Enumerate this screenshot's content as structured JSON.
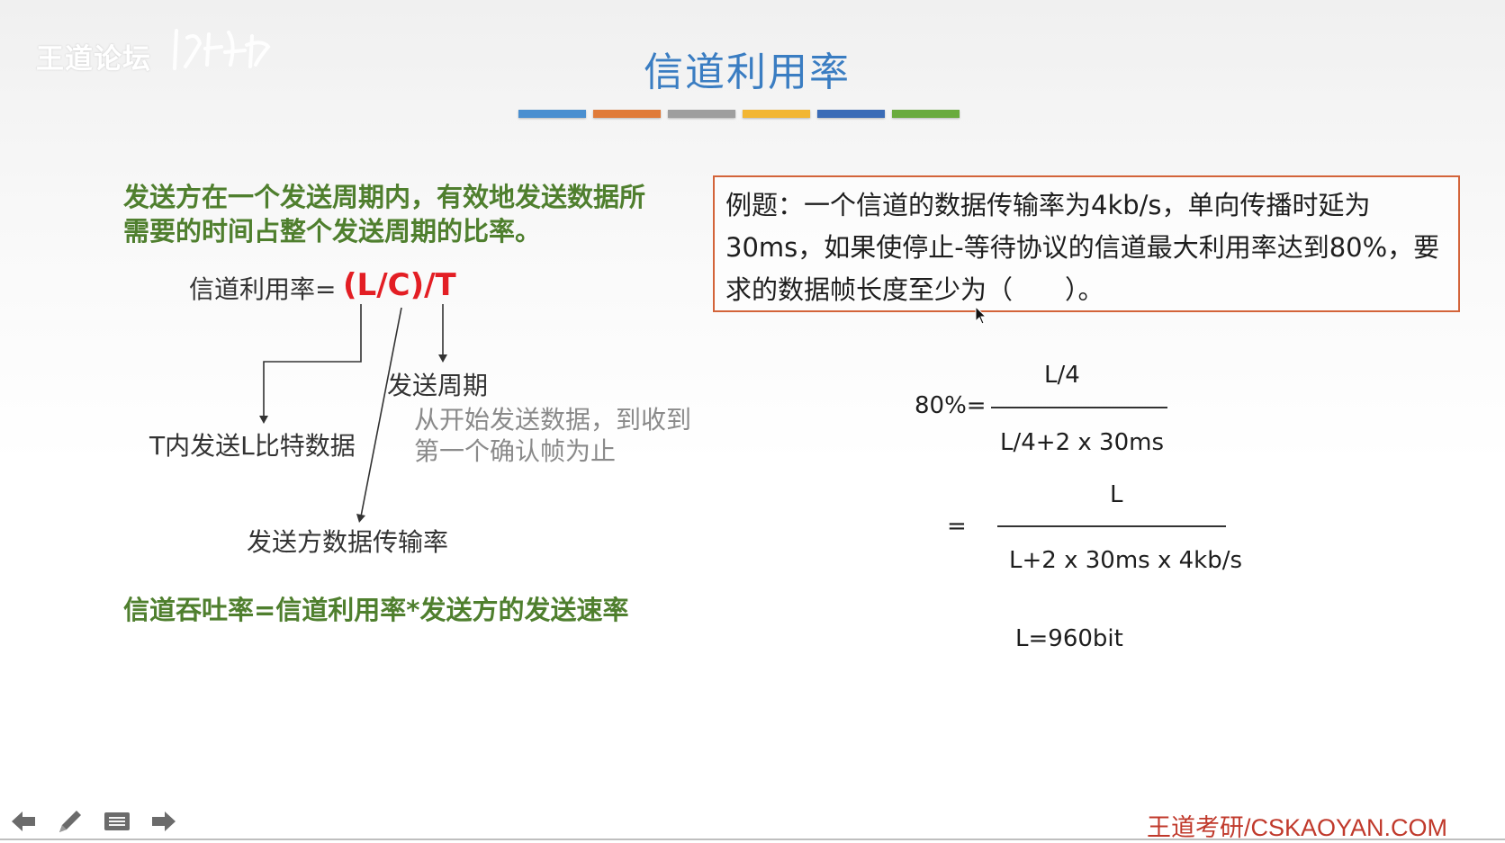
{
  "watermark": {
    "text": "王道论坛"
  },
  "slide": {
    "title": "信道利用率",
    "color_bars": [
      "#4a8fd0",
      "#e07b39",
      "#9e9e9e",
      "#f2b633",
      "#3b6cb7",
      "#6aab3e"
    ]
  },
  "left": {
    "definition": "发送方在一个发送周期内，有效地发送数据所需要的时间占整个发送周期的比率。",
    "formula_label": "信道利用率=",
    "formula_expr": "(L/C)/T",
    "send_period": "发送周期",
    "period_desc": "从开始发送数据，到收到第一个确认帧为止",
    "L_bits": "T内发送L比特数据",
    "sender_rate": "发送方数据传输率",
    "throughput": "信道吞吐率=信道利用率*发送方的发送速率"
  },
  "example": {
    "text": "例题：一个信道的数据传输率为4kb/s，单向传播时延为30ms，如果使停止-等待协议的信道最大利用率达到80%，要求的数据帧长度至少为（　　）。"
  },
  "solution": {
    "lhs1": "80%=",
    "num1": "L/4",
    "den1": "L/4+2 x 30ms",
    "eq2": "=",
    "num2": "L",
    "den2": "L+2 x 30ms x 4kb/s",
    "result": "L=960bit"
  },
  "toolbar": {
    "icons": [
      "arrow-left-icon",
      "pen-icon",
      "menu-icon",
      "arrow-right-icon"
    ]
  },
  "footer": {
    "brand": "王道考研/CSKAOYAN.COM"
  }
}
